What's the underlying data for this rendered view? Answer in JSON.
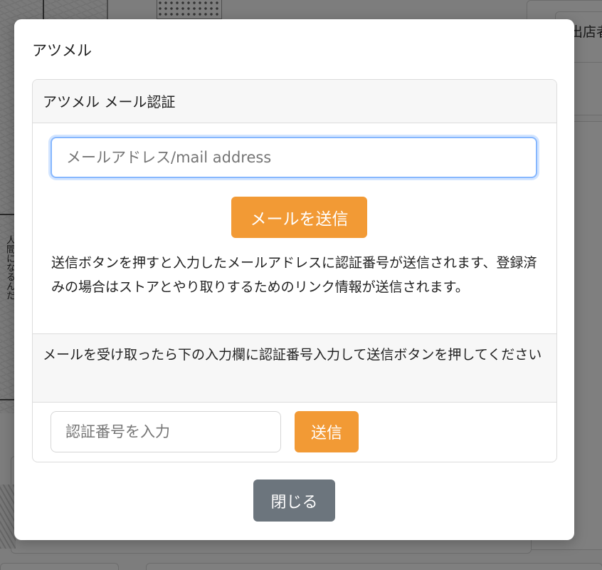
{
  "background": {
    "shop_fragment": "出店者",
    "vertical_text": "人間になるんだ"
  },
  "modal": {
    "title": "アツメル",
    "card": {
      "header": "アツメル メール認証",
      "email_placeholder": "メールアドレス/mail address",
      "send_mail_button": "メールを送信",
      "description": "送信ボタンを押すと入力したメールアドレスに認証番号が送信されます、登録済みの場合はストアとやり取りするためのリンク情報が送信されます。",
      "code_section_text": "メールを受け取ったら下の入力欄に認証番号入力して送信ボタンを押してください",
      "code_placeholder": "認証番号を入力",
      "send_code_button": "送信"
    },
    "close_button": "閉じる"
  },
  "colors": {
    "accent_orange": "#f29a35",
    "close_gray": "#6c757d",
    "focus_blue": "#86b7fe",
    "overlay": "rgba(0,0,0,0.5)"
  }
}
